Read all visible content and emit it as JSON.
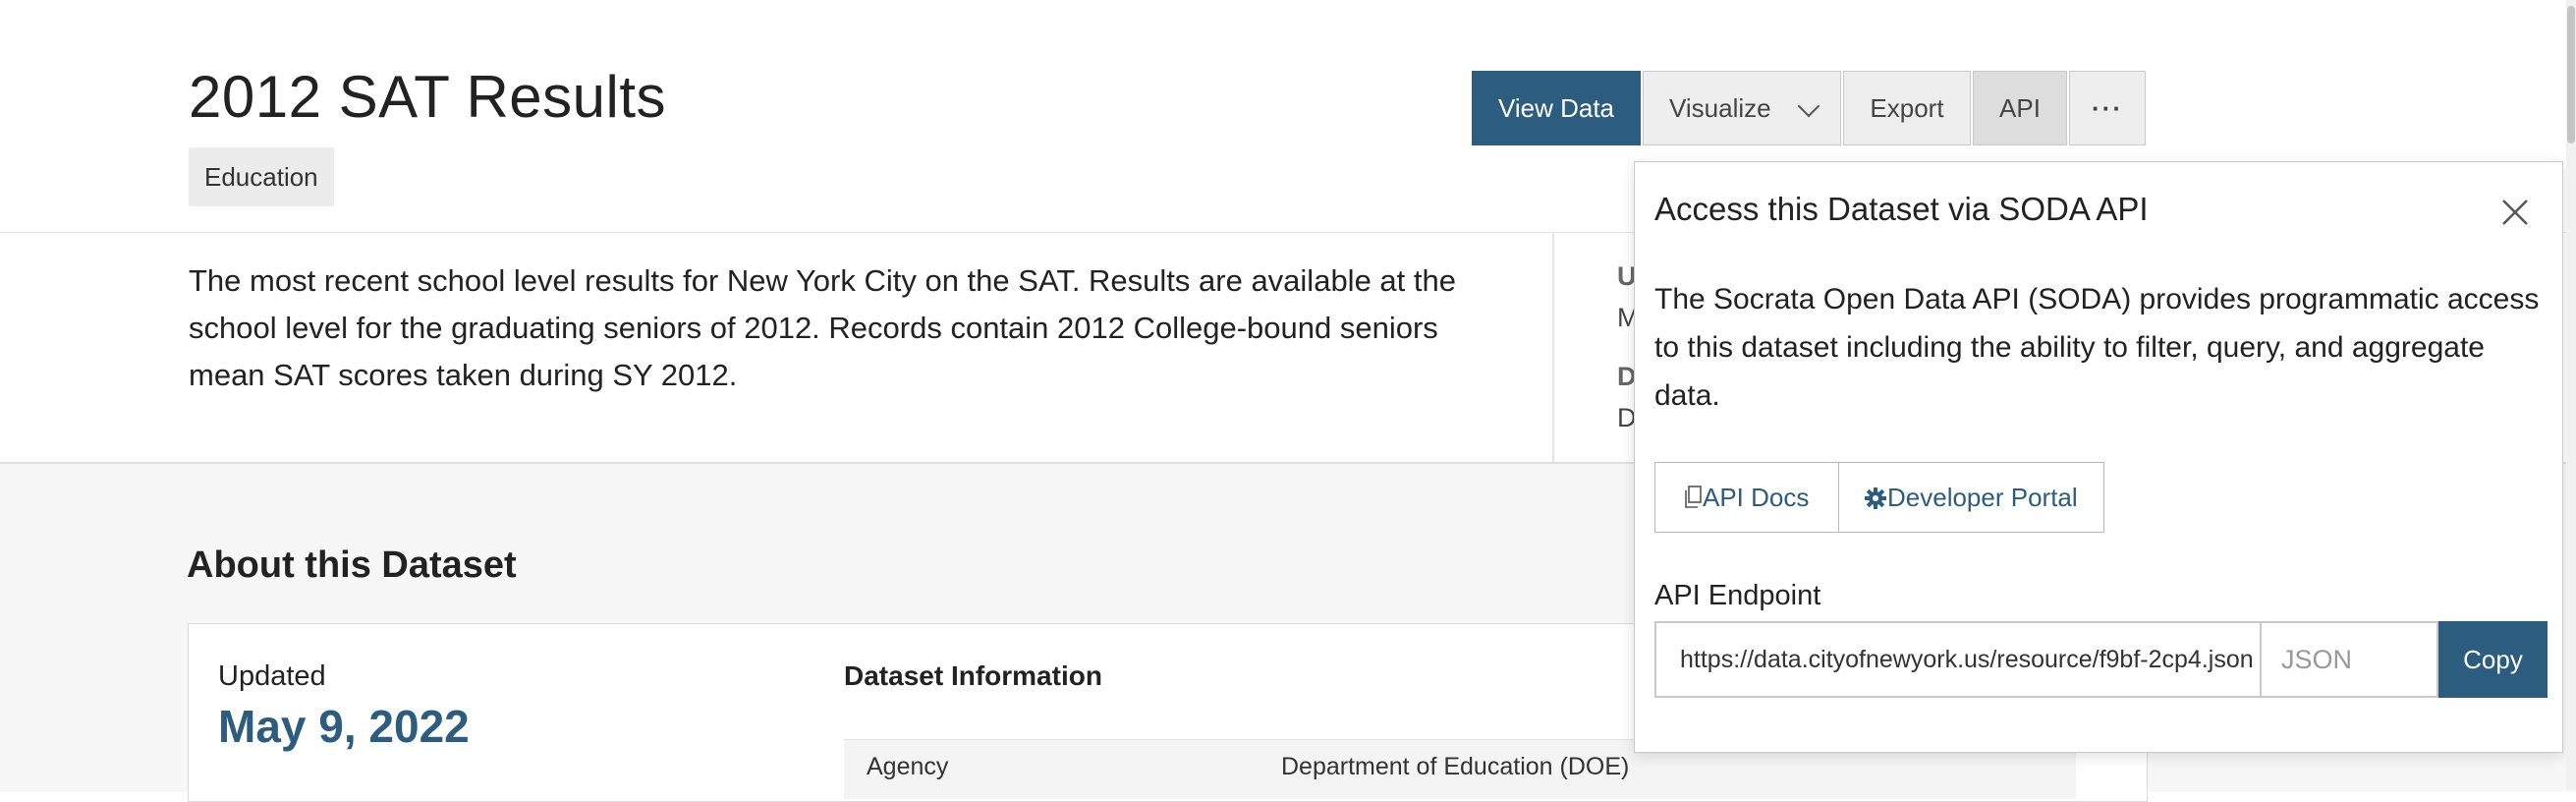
{
  "header": {
    "title": "2012 SAT Results",
    "category_tag": "Education",
    "description": "The most recent school level results for New York City on the SAT. Results are available at the school level for the graduating seniors of 2012. Records contain 2012 College-bound seniors mean SAT scores taken during SY 2012."
  },
  "toolbar": {
    "view_data": "View Data",
    "visualize": "Visualize",
    "export": "Export",
    "api": "API",
    "more": "···"
  },
  "sidebar_partial": {
    "label1": "U",
    "value1": "M",
    "label2": "D",
    "value2": "D"
  },
  "about": {
    "heading": "About this Dataset",
    "updated_label": "Updated",
    "updated_date": "May 9, 2022",
    "dataset_info_heading": "Dataset Information",
    "rows": [
      {
        "key": "Agency",
        "value": "Department of Education (DOE)"
      }
    ]
  },
  "api_panel": {
    "title": "Access this Dataset via SODA API",
    "description": "The Socrata Open Data API (SODA) provides programmatic access to this dataset including the ability to filter, query, and aggregate data.",
    "api_docs": "API Docs",
    "developer_portal": "Developer Portal",
    "endpoint_label": "API Endpoint",
    "endpoint_url": "https://data.cityofnewyork.us/resource/f9bf-2cp4.json",
    "format": "JSON",
    "copy": "Copy"
  },
  "colors": {
    "accent": "#2c5d7f",
    "tag_bg": "#ececec",
    "section_bg": "#f7f7f7"
  }
}
